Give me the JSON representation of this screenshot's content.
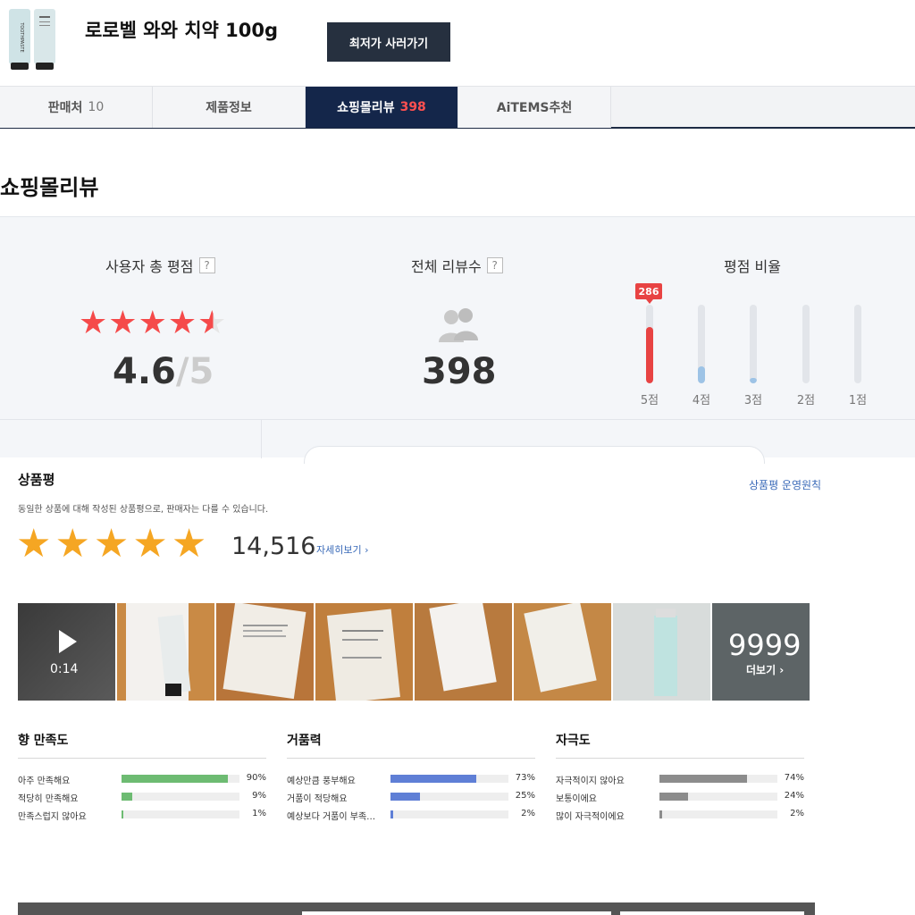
{
  "header": {
    "title": "로로벨 와와 치약 100g",
    "buy_button": "최저가 사러가기",
    "thumbnail_text": "TOOTHPASTE"
  },
  "tabs": [
    {
      "label": "판매처",
      "count": "10",
      "active": false
    },
    {
      "label": "제품정보",
      "count": "",
      "active": false
    },
    {
      "label": "쇼핑몰리뷰",
      "count": "398",
      "active": true
    },
    {
      "label": "AiTEMS추천",
      "count": "",
      "active": false
    }
  ],
  "section_title": "쇼핑몰리뷰",
  "summary": {
    "rating_label": "사용자 총 평점",
    "help_mark": "?",
    "rating_value": "4.6",
    "rating_max": "5",
    "rating_fraction": 0.92,
    "reviews_label": "전체 리뷰수",
    "reviews_count": "398",
    "ratio_label": "평점 비율",
    "ratio_badge": "286",
    "ratio": [
      {
        "label": "5점",
        "fraction": 0.72,
        "color": "#e84343"
      },
      {
        "label": "4점",
        "fraction": 0.22,
        "color": "#9dc3e6"
      },
      {
        "label": "3점",
        "fraction": 0.07,
        "color": "#9dc3e6"
      },
      {
        "label": "2점",
        "fraction": 0.0,
        "color": "#9dc3e6"
      },
      {
        "label": "1점",
        "fraction": 0.0,
        "color": "#9dc3e6"
      }
    ]
  },
  "product_review": {
    "title": "상품평",
    "policy_link": "상품평 운영원칙",
    "notice": "동일한 상품에 대해 작성된 상품평으로, 판매자는 다를 수 있습니다.",
    "star_count": 5,
    "count": "14,516",
    "detail_link": "자세히보기",
    "video_duration": "0:14",
    "more_count": "9999",
    "more_link": "더보기"
  },
  "attributes": [
    {
      "title": "향 만족도",
      "color": "#6dbb72",
      "rows": [
        {
          "label": "아주 만족해요",
          "pct": "90%",
          "value": 0.9
        },
        {
          "label": "적당히 만족해요",
          "pct": "9%",
          "value": 0.09
        },
        {
          "label": "만족스럽지 않아요",
          "pct": "1%",
          "value": 0.01
        }
      ]
    },
    {
      "title": "거품력",
      "color": "#5f7fd6",
      "rows": [
        {
          "label": "예상만큼 풍부해요",
          "pct": "73%",
          "value": 0.73
        },
        {
          "label": "거품이 적당해요",
          "pct": "25%",
          "value": 0.25
        },
        {
          "label": "예상보다 거품이 부족…",
          "pct": "2%",
          "value": 0.02
        }
      ]
    },
    {
      "title": "자극도",
      "color": "#8c8c8c",
      "rows": [
        {
          "label": "자극적이지 않아요",
          "pct": "74%",
          "value": 0.74
        },
        {
          "label": "보통이에요",
          "pct": "24%",
          "value": 0.24
        },
        {
          "label": "많이 자극적이에요",
          "pct": "2%",
          "value": 0.02
        }
      ]
    }
  ]
}
